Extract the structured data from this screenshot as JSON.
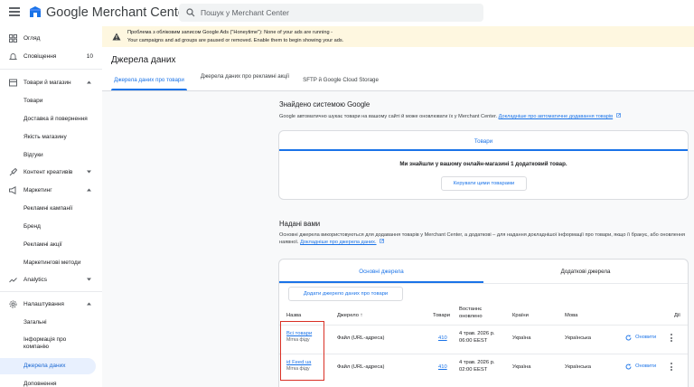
{
  "app": {
    "title": "Google Merchant Center Next",
    "search_placeholder": "Пошук у Merchant Center"
  },
  "banner": {
    "line1": "Проблема з обліковим записом Google Ads (\"Honeytime\"): None of your ads are running -",
    "line2": "Your campaigns and ad groups are paused or removed. Enable them to begin showing your ads."
  },
  "sidebar": {
    "overview": "Огляд",
    "notifications": "Сповіщення",
    "notifications_count": "10",
    "products_store": "Товари й магазин",
    "products": "Товари",
    "shipping": "Доставка й повернення",
    "store_quality": "Якість магазину",
    "reviews": "Відгуки",
    "creative": "Контент креативів",
    "marketing": "Маркетинг",
    "ad_campaigns": "Рекламні кампанії",
    "brand": "Бренд",
    "promotions": "Рекламні акції",
    "marketing_methods": "Маркетингові методи",
    "analytics": "Analytics",
    "settings": "Налаштування",
    "general": "Загальні",
    "company_info": "Інформація про компанію",
    "data_sources": "Джерела даних",
    "addons": "Доповнення"
  },
  "main": {
    "title": "Джерела даних",
    "tabs": [
      "Джерела даних про товари",
      "Джерела даних про рекламні акції",
      "SFTP й Google Cloud Storage"
    ],
    "found": {
      "title": "Знайдено системою Google",
      "desc": "Google автоматично шукає товари на вашому сайті й може оновлювати їх у Merchant Center.",
      "link": "Докладніше про автоматичне додавання товарів",
      "card_tab": "Товари",
      "message": "Ми знайшли у вашому онлайн-магазині 1 додатковий товар.",
      "button": "Керувати цими товарами"
    },
    "provided": {
      "title": "Надані вами",
      "desc": "Основні джерела використовуються для додавання товарів у Merchant Center, а додаткові – для надання докладнішої інформації про товари, якщо її бракує, або оновлення наявної.",
      "link": "Докладніше про джерела даних.",
      "tabs": [
        "Основні джерела",
        "Додаткові джерела"
      ],
      "add_button": "Додати джерело даних про товари",
      "columns": {
        "name": "Назва",
        "source": "Джерело",
        "sort_arrow": "↑",
        "products": "Товари",
        "updated": "Востаннє оновлено",
        "countries": "Країни",
        "language": "Мова",
        "actions": "Дії"
      },
      "rows": [
        {
          "name": "Всі товари",
          "label": "Мітка фіду",
          "source": "Файл (URL-адреса)",
          "products": "410",
          "updated_date": "4 трав. 2026 р.",
          "updated_time": "06:00 EEST",
          "country": "Україна",
          "language": "Українська",
          "action": "Оновити"
        },
        {
          "name": "id Feed ua",
          "label": "Мітка фіду",
          "source": "Файл (URL-адреса)",
          "products": "410",
          "updated_date": "4 трав. 2026 р.",
          "updated_time": "02:00 EEST",
          "country": "Україна",
          "language": "Українська",
          "action": "Оновити"
        }
      ]
    }
  },
  "colors": {
    "accent": "#1a73e8",
    "banner_bg": "#fef7e0",
    "active_nav_bg": "#e8f0fe",
    "highlight": "#d93025"
  }
}
